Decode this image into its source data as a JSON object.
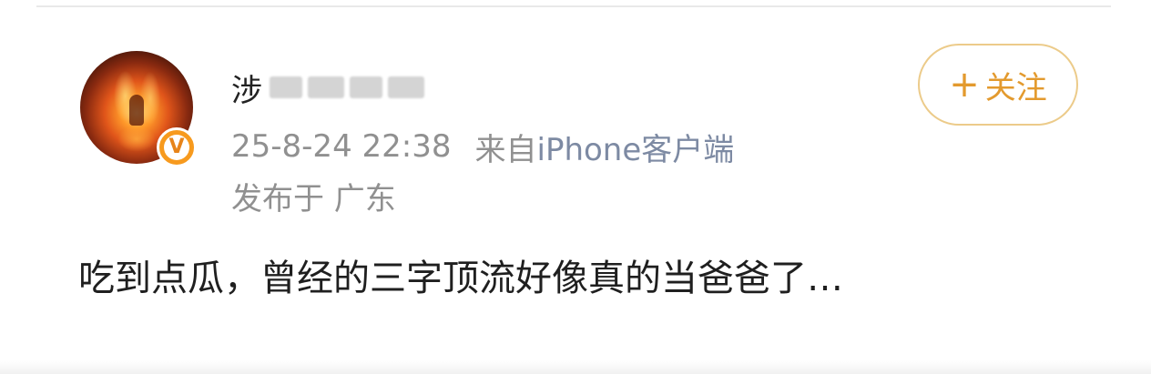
{
  "post": {
    "author": {
      "name_visible": "涉"
    },
    "timestamp": "25-8-24 22:38",
    "source_prefix": "来自",
    "source": "iPhone客户端",
    "location": "发布于 广东",
    "text": "吃到点瓜，曾经的三字顶流好像真的当爸爸了…",
    "follow_label": "关注",
    "follow_symbol": "+",
    "verified_badge": "V"
  },
  "icons": {
    "verified": "verified-v-icon",
    "plus": "plus-icon"
  },
  "colors": {
    "follow_accent": "#e39a2e",
    "follow_border": "#eccb8a",
    "badge": "#f79a1e",
    "meta_text": "#909090",
    "source_text": "#7d8aa3",
    "body_text": "#1f1f1f"
  }
}
